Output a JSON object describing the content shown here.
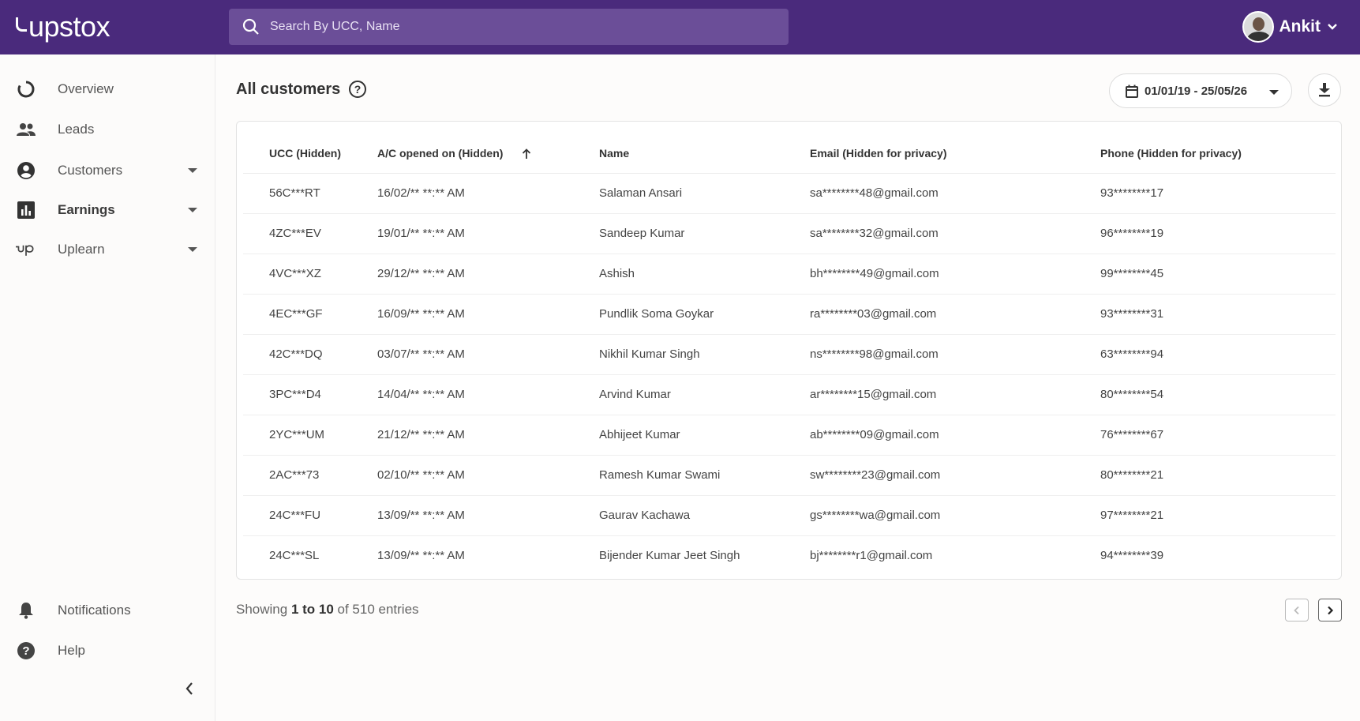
{
  "header": {
    "logo_text": "upstox",
    "search_placeholder": "Search By UCC, Name",
    "user_name": "Ankit"
  },
  "sidebar": {
    "items": [
      {
        "label": "Overview",
        "icon": "overview-ring-icon"
      },
      {
        "label": "Leads",
        "icon": "people-icon"
      },
      {
        "label": "Customers",
        "icon": "account-circle-icon"
      },
      {
        "label": "Earnings",
        "icon": "bar-chart-icon"
      },
      {
        "label": "Uplearn",
        "icon": "uplearn-logo-icon"
      }
    ],
    "bottom_items": [
      {
        "label": "Notifications",
        "icon": "bell-icon"
      },
      {
        "label": "Help",
        "icon": "help-circle-icon"
      }
    ]
  },
  "main": {
    "title": "All customers",
    "date_range": "01/01/19 - 25/05/26",
    "columns": [
      "UCC (Hidden)",
      "A/C opened on (Hidden)",
      "Name",
      "Email (Hidden for privacy)",
      "Phone (Hidden for privacy)"
    ],
    "rows": [
      [
        "56C***RT",
        "16/02/** **:** AM",
        "Salaman Ansari",
        "sa********48@gmail.com",
        "93********17"
      ],
      [
        "4ZC***EV",
        "19/01/** **:** AM",
        "Sandeep Kumar",
        "sa********32@gmail.com",
        "96********19"
      ],
      [
        "4VC***XZ",
        "29/12/** **:** AM",
        "Ashish",
        "bh********49@gmail.com",
        "99********45"
      ],
      [
        "4EC***GF",
        "16/09/** **:** AM",
        "Pundlik Soma Goykar",
        "ra********03@gmail.com",
        "93********31"
      ],
      [
        "42C***DQ",
        "03/07/** **:** AM",
        "Nikhil Kumar Singh",
        "ns********98@gmail.com",
        "63********94"
      ],
      [
        "3PC***D4",
        "14/04/** **:** AM",
        "Arvind Kumar",
        "ar********15@gmail.com",
        "80********54"
      ],
      [
        "2YC***UM",
        "21/12/** **:** AM",
        "Abhijeet Kumar",
        "ab********09@gmail.com",
        "76********67"
      ],
      [
        "2AC***73",
        "02/10/** **:** AM",
        "Ramesh Kumar Swami",
        "sw********23@gmail.com",
        "80********21"
      ],
      [
        "24C***FU",
        "13/09/** **:** AM",
        "Gaurav Kachawa",
        "gs********wa@gmail.com",
        "97********21"
      ],
      [
        "24C***SL",
        "13/09/** **:** AM",
        "Bijender Kumar Jeet Singh",
        "bj********r1@gmail.com",
        "94********39"
      ]
    ],
    "footer": {
      "prefix": "Showing ",
      "range": "1 to 10",
      "suffix": " of 510 entries"
    }
  },
  "colors": {
    "header_bg": "#4a2a7c",
    "search_bg": "#6b4e98"
  }
}
